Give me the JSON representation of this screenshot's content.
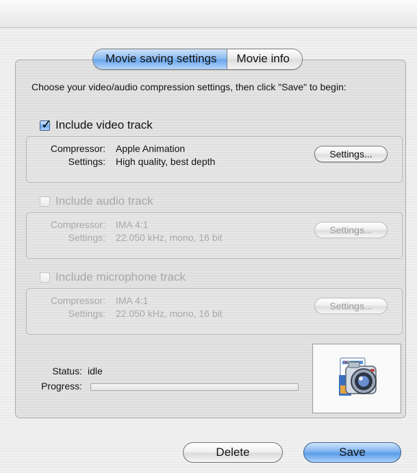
{
  "tabs": [
    {
      "label": "Movie saving settings",
      "active": true
    },
    {
      "label": "Movie info",
      "active": false
    }
  ],
  "instructions": "Choose your video/audio compression settings, then click \"Save\" to begin:",
  "video": {
    "checkbox_label": "Include video track",
    "checked": true,
    "compressor_label": "Compressor:",
    "compressor_value": "Apple Animation",
    "settings_label": "Settings:",
    "settings_value": "High quality, best depth",
    "settings_button": "Settings..."
  },
  "audio": {
    "checkbox_label": "Include audio track",
    "checked": false,
    "compressor_label": "Compressor:",
    "compressor_value": "IMA 4:1",
    "settings_label": "Settings:",
    "settings_value": "22.050 kHz, mono, 16 bit",
    "settings_button": "Settings..."
  },
  "microphone": {
    "checkbox_label": "Include microphone track",
    "checked": false,
    "compressor_label": "Compressor:",
    "compressor_value": "IMA 4:1",
    "settings_label": "Settings:",
    "settings_value": "22.050 kHz, mono, 16 bit",
    "settings_button": "Settings..."
  },
  "status": {
    "status_label": "Status:",
    "status_value": "idle",
    "progress_label": "Progress:",
    "progress_value": 0
  },
  "preview_icon": "camera-icon",
  "buttons": {
    "delete": "Delete",
    "save": "Save"
  },
  "colors": {
    "accent_blue": "#6aa6ec",
    "disabled_text": "#a8a8a8"
  }
}
